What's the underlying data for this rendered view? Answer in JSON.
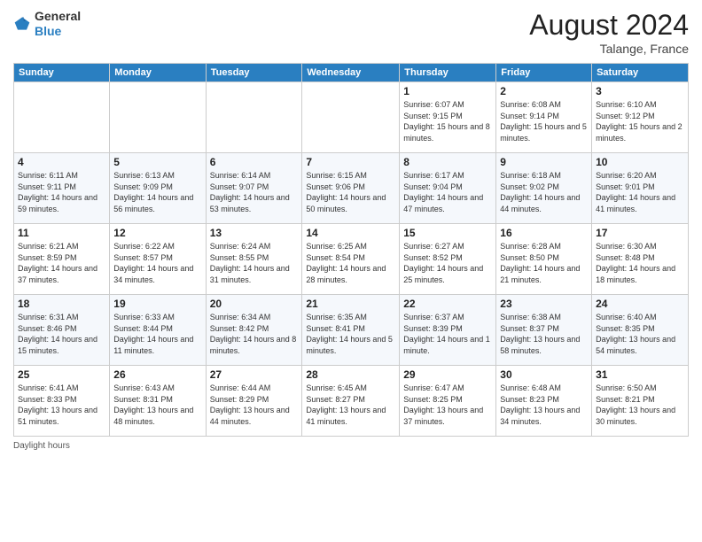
{
  "header": {
    "logo_general": "General",
    "logo_blue": "Blue",
    "month_year": "August 2024",
    "location": "Talange, France"
  },
  "days_of_week": [
    "Sunday",
    "Monday",
    "Tuesday",
    "Wednesday",
    "Thursday",
    "Friday",
    "Saturday"
  ],
  "weeks": [
    [
      {
        "day": "",
        "info": ""
      },
      {
        "day": "",
        "info": ""
      },
      {
        "day": "",
        "info": ""
      },
      {
        "day": "",
        "info": ""
      },
      {
        "day": "1",
        "info": "Sunrise: 6:07 AM\nSunset: 9:15 PM\nDaylight: 15 hours\nand 8 minutes."
      },
      {
        "day": "2",
        "info": "Sunrise: 6:08 AM\nSunset: 9:14 PM\nDaylight: 15 hours\nand 5 minutes."
      },
      {
        "day": "3",
        "info": "Sunrise: 6:10 AM\nSunset: 9:12 PM\nDaylight: 15 hours\nand 2 minutes."
      }
    ],
    [
      {
        "day": "4",
        "info": "Sunrise: 6:11 AM\nSunset: 9:11 PM\nDaylight: 14 hours\nand 59 minutes."
      },
      {
        "day": "5",
        "info": "Sunrise: 6:13 AM\nSunset: 9:09 PM\nDaylight: 14 hours\nand 56 minutes."
      },
      {
        "day": "6",
        "info": "Sunrise: 6:14 AM\nSunset: 9:07 PM\nDaylight: 14 hours\nand 53 minutes."
      },
      {
        "day": "7",
        "info": "Sunrise: 6:15 AM\nSunset: 9:06 PM\nDaylight: 14 hours\nand 50 minutes."
      },
      {
        "day": "8",
        "info": "Sunrise: 6:17 AM\nSunset: 9:04 PM\nDaylight: 14 hours\nand 47 minutes."
      },
      {
        "day": "9",
        "info": "Sunrise: 6:18 AM\nSunset: 9:02 PM\nDaylight: 14 hours\nand 44 minutes."
      },
      {
        "day": "10",
        "info": "Sunrise: 6:20 AM\nSunset: 9:01 PM\nDaylight: 14 hours\nand 41 minutes."
      }
    ],
    [
      {
        "day": "11",
        "info": "Sunrise: 6:21 AM\nSunset: 8:59 PM\nDaylight: 14 hours\nand 37 minutes."
      },
      {
        "day": "12",
        "info": "Sunrise: 6:22 AM\nSunset: 8:57 PM\nDaylight: 14 hours\nand 34 minutes."
      },
      {
        "day": "13",
        "info": "Sunrise: 6:24 AM\nSunset: 8:55 PM\nDaylight: 14 hours\nand 31 minutes."
      },
      {
        "day": "14",
        "info": "Sunrise: 6:25 AM\nSunset: 8:54 PM\nDaylight: 14 hours\nand 28 minutes."
      },
      {
        "day": "15",
        "info": "Sunrise: 6:27 AM\nSunset: 8:52 PM\nDaylight: 14 hours\nand 25 minutes."
      },
      {
        "day": "16",
        "info": "Sunrise: 6:28 AM\nSunset: 8:50 PM\nDaylight: 14 hours\nand 21 minutes."
      },
      {
        "day": "17",
        "info": "Sunrise: 6:30 AM\nSunset: 8:48 PM\nDaylight: 14 hours\nand 18 minutes."
      }
    ],
    [
      {
        "day": "18",
        "info": "Sunrise: 6:31 AM\nSunset: 8:46 PM\nDaylight: 14 hours\nand 15 minutes."
      },
      {
        "day": "19",
        "info": "Sunrise: 6:33 AM\nSunset: 8:44 PM\nDaylight: 14 hours\nand 11 minutes."
      },
      {
        "day": "20",
        "info": "Sunrise: 6:34 AM\nSunset: 8:42 PM\nDaylight: 14 hours\nand 8 minutes."
      },
      {
        "day": "21",
        "info": "Sunrise: 6:35 AM\nSunset: 8:41 PM\nDaylight: 14 hours\nand 5 minutes."
      },
      {
        "day": "22",
        "info": "Sunrise: 6:37 AM\nSunset: 8:39 PM\nDaylight: 14 hours\nand 1 minute."
      },
      {
        "day": "23",
        "info": "Sunrise: 6:38 AM\nSunset: 8:37 PM\nDaylight: 13 hours\nand 58 minutes."
      },
      {
        "day": "24",
        "info": "Sunrise: 6:40 AM\nSunset: 8:35 PM\nDaylight: 13 hours\nand 54 minutes."
      }
    ],
    [
      {
        "day": "25",
        "info": "Sunrise: 6:41 AM\nSunset: 8:33 PM\nDaylight: 13 hours\nand 51 minutes."
      },
      {
        "day": "26",
        "info": "Sunrise: 6:43 AM\nSunset: 8:31 PM\nDaylight: 13 hours\nand 48 minutes."
      },
      {
        "day": "27",
        "info": "Sunrise: 6:44 AM\nSunset: 8:29 PM\nDaylight: 13 hours\nand 44 minutes."
      },
      {
        "day": "28",
        "info": "Sunrise: 6:45 AM\nSunset: 8:27 PM\nDaylight: 13 hours\nand 41 minutes."
      },
      {
        "day": "29",
        "info": "Sunrise: 6:47 AM\nSunset: 8:25 PM\nDaylight: 13 hours\nand 37 minutes."
      },
      {
        "day": "30",
        "info": "Sunrise: 6:48 AM\nSunset: 8:23 PM\nDaylight: 13 hours\nand 34 minutes."
      },
      {
        "day": "31",
        "info": "Sunrise: 6:50 AM\nSunset: 8:21 PM\nDaylight: 13 hours\nand 30 minutes."
      }
    ]
  ],
  "footer": {
    "daylight_label": "Daylight hours"
  }
}
